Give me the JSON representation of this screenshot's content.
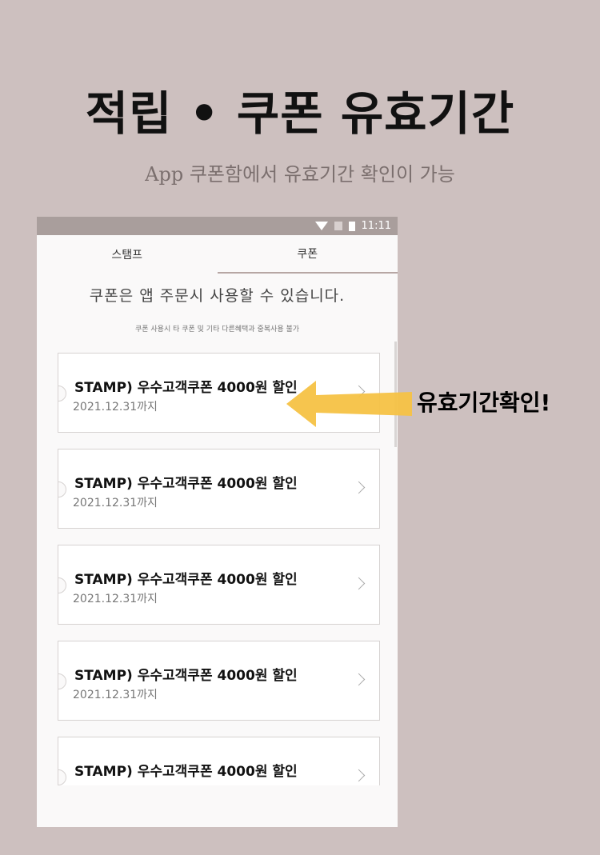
{
  "headline": "적립 • 쿠폰 유효기간",
  "subline": "App 쿠폰함에서 유효기간 확인이 가능",
  "status": {
    "time": "11:11"
  },
  "tabs": [
    {
      "label": "스탬프"
    },
    {
      "label": "쿠폰"
    }
  ],
  "notice": "쿠폰은 앱 주문시 사용할 수 있습니다.",
  "subnotice": "쿠폰 사용시 타 쿠폰 및 기타 다른혜택과 중복사용 불가",
  "coupons": [
    {
      "title": "STAMP) 우수고객쿠폰 4000원 할인",
      "date": "2021.12.31까지"
    },
    {
      "title": "STAMP) 우수고객쿠폰 4000원 할인",
      "date": "2021.12.31까지"
    },
    {
      "title": "STAMP) 우수고객쿠폰 4000원 할인",
      "date": "2021.12.31까지"
    },
    {
      "title": "STAMP) 우수고객쿠폰 4000원 할인",
      "date": "2021.12.31까지"
    },
    {
      "title": "STAMP) 우수고객쿠폰 4000원 할인",
      "date": ""
    }
  ],
  "callout": "유효기간확인!",
  "colors": {
    "background": "#cdc0bf",
    "statusbar": "#a99e9c",
    "arrow": "#f6c244"
  }
}
